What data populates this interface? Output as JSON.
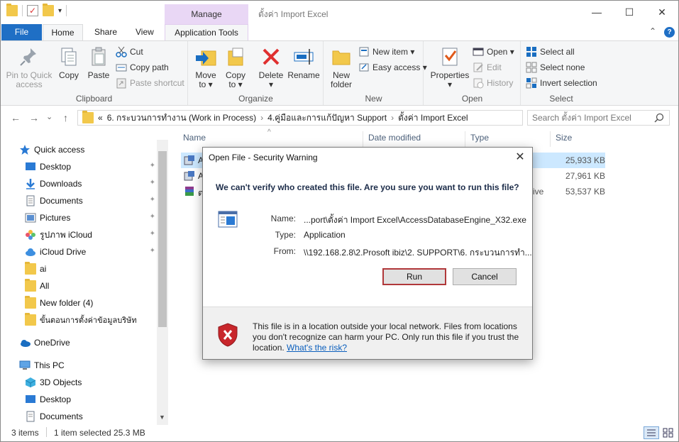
{
  "titlebar": {
    "manage_label": "Manage",
    "title": "ตั้งค่า Import Excel",
    "minimize": "—",
    "maximize": "☐",
    "close": "✕"
  },
  "tabs": {
    "file": "File",
    "home": "Home",
    "share": "Share",
    "view": "View",
    "app_tools": "Application Tools"
  },
  "ribbon": {
    "clipboard": {
      "label": "Clipboard",
      "pin_line1": "Pin to Quick",
      "pin_line2": "access",
      "copy": "Copy",
      "paste": "Paste",
      "cut": "Cut",
      "copy_path": "Copy path",
      "paste_shortcut": "Paste shortcut"
    },
    "organize": {
      "label": "Organize",
      "move_to_1": "Move",
      "move_to_2": "to ▾",
      "copy_to_1": "Copy",
      "copy_to_2": "to ▾",
      "delete_1": "Delete",
      "delete_2": "▾",
      "rename": "Rename"
    },
    "new": {
      "label": "New",
      "new_folder_1": "New",
      "new_folder_2": "folder",
      "new_item": "New item ▾",
      "easy_access": "Easy access ▾"
    },
    "open": {
      "label": "Open",
      "properties_1": "Properties",
      "properties_2": "▾",
      "open": "Open ▾",
      "edit": "Edit",
      "history": "History"
    },
    "select": {
      "label": "Select",
      "select_all": "Select all",
      "select_none": "Select none",
      "invert": "Invert selection"
    }
  },
  "address": {
    "back": "←",
    "forward": "→",
    "recent": "⌄",
    "up": "↑",
    "overflow": "«",
    "crumb1": "6. กระบวนการทำงาน (Work in Process)",
    "crumb2": "4.คู่มือและการแก้ปัญหา Support",
    "crumb3": "ตั้งค่า Import Excel",
    "sep": "›",
    "search_placeholder": "Search ตั้งค่า Import Excel"
  },
  "nav": {
    "quick_access": "Quick access",
    "desktop": "Desktop",
    "downloads": "Downloads",
    "documents": "Documents",
    "pictures": "Pictures",
    "icloud_photos": "รูปภาพ iCloud",
    "icloud_drive": "iCloud Drive",
    "ai": "ai",
    "all": "All",
    "new_folder": "New folder (4)",
    "steps": "ขั้นตอนการตั้งค่าข้อมูลบริษัท",
    "onedrive": "OneDrive",
    "this_pc": "This PC",
    "objects3d": "3D Objects",
    "desktop2": "Desktop",
    "documents2": "Documents",
    "pin": "📌"
  },
  "files": {
    "col_name": "Name",
    "col_date": "Date modified",
    "col_type": "Type",
    "col_size": "Size",
    "sort_arrow": "^",
    "rows": [
      {
        "name": "A",
        "size": "25,933 KB"
      },
      {
        "name": "A",
        "size": "27,961 KB"
      },
      {
        "name": "ต",
        "type_tail": "ive",
        "size": "53,537 KB"
      }
    ]
  },
  "status": {
    "items": "3 items",
    "selected": "1 item selected  25.3 MB"
  },
  "dialog": {
    "title": "Open File - Security Warning",
    "close": "✕",
    "question": "We can't verify who created this file. Are you sure you want to run this file?",
    "name_label": "Name:",
    "name_value": "...port\\ตั้งค่า Import Excel\\AccessDatabaseEngine_X32.exe",
    "type_label": "Type:",
    "type_value": "Application",
    "from_label": "From:",
    "from_value": "\\\\192.168.2.8\\2.Prosoft ibiz\\2. SUPPORT\\6. กระบวนการทำ...",
    "run": "Run",
    "cancel": "Cancel",
    "warning_text": "This file is in a location outside your local network. Files from locations you don't recognize can harm your PC. Only run this file if you trust the location. ",
    "risk_link": "What's the risk?"
  }
}
